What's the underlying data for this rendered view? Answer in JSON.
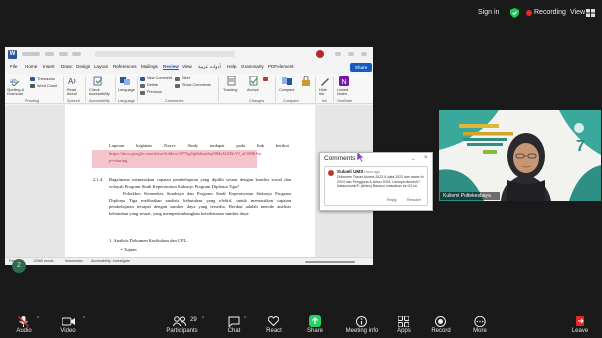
{
  "zoom_top": {
    "sign_in": "Sign in",
    "recording": "Recording",
    "view": "View"
  },
  "word": {
    "title_right_icons": "",
    "menu_tabs": [
      "File",
      "Home",
      "Insert",
      "Draw",
      "Design",
      "Layout",
      "References",
      "Mailings",
      "Review",
      "View",
      "أدوات عربية",
      "Help",
      "Grammarly",
      "PDFelement"
    ],
    "share": "Share",
    "ribbon": {
      "spelling": "Spelling & Grammar",
      "thesaurus": "Thesaurus",
      "word_count": "Word Count",
      "group_proofing": "Proofing",
      "read_aloud": "Read Aloud",
      "group_speech": "Speech",
      "check_accessibility": "Check Accessibility",
      "group_accessibility": "Accessibility",
      "language": "Language",
      "group_language": "Language",
      "new_comment": "New Comment",
      "delete": "Delete",
      "previous": "Previous",
      "next": "Next",
      "show_comments": "Show Comments",
      "group_comments": "Comments",
      "tracking": "Tracking",
      "accept": "Accept",
      "group_changes": "Changes",
      "compare": "Compare",
      "group_compare": "Compare",
      "hide_ink": "Hide Ink",
      "group_ink": "Ink",
      "linked_notes": "Linked Notes",
      "group_onenote": "OneNote"
    },
    "document": {
      "line1_words": [
        "Laporan",
        "kegiatan",
        "Tracer",
        "Study",
        "terdapat",
        "pada",
        "link",
        "berikut"
      ],
      "link_line1": "https://docs.google.com/drive/folders/1P7kg5qbbleaedqr98dvJkXRcVf_aOiMb?us",
      "link_line2": "p=sharing",
      "section_number": "2.1.4",
      "section_heading": "Bagaimana memastikan capaian pembelajaran yang dipilih sesuai dengan kondisi sosial dan wilayah Program Studi Keperawatan Sidoarjo Program Diploma Tiga?",
      "paragraph": "Poltekkes Kemenkes Surabaya dan Program Studi Keperawatan Sidoarjo Program Diploma Tiga melibatkan analisis kebutuhan yang efektif, untuk memastikan capaian pembelajaran terrapai dengan sumber daya yang tersedia. Berikut adalah metode analisis kebutuhan yang sesuai, yang mempertimbangkan keterbatasan sumber daya:",
      "list_item": "1. Analisis Dokumen Kurikulum dan CPL:",
      "bullet": "Tujuan"
    },
    "status": {
      "page": "Page 1 ...",
      "words": "13365 words",
      "language": "Indonesian",
      "accessibility": "Accessibility: Investigate"
    }
  },
  "comments_pane": {
    "title": "Comments",
    "author": "Sulaeli UMS",
    "time": "2 hours ago",
    "text": "Dokumen Tracer Alumni 2023 & data 2022 dan tracer th 2024 dan Pengguna & tahun 2024. Lainnya diunduh? Natsuchunk/Tr (slides) Bandoo masukkan ke f13 ini",
    "reply": "Reply",
    "resolve": "Resolve"
  },
  "video_tile": {
    "participant_name": "Kuliemi Poltekesbaya",
    "banner_number": "7"
  },
  "bubble_initials": "Z",
  "toolbar": {
    "audio": "Audio",
    "video": "Video",
    "participants": "Participants",
    "participant_count": "29",
    "chat": "Chat",
    "react": "React",
    "share": "Share",
    "meeting_info": "Meeting info",
    "apps": "Apps",
    "record": "Record",
    "more": "More",
    "leave": "Leave"
  },
  "colors": {
    "zoom_bg": "#1a1a1a",
    "word_blue": "#185abd",
    "share_green": "#23d366",
    "record_red": "#e02828",
    "link_highlight": "#f4c6cc"
  }
}
